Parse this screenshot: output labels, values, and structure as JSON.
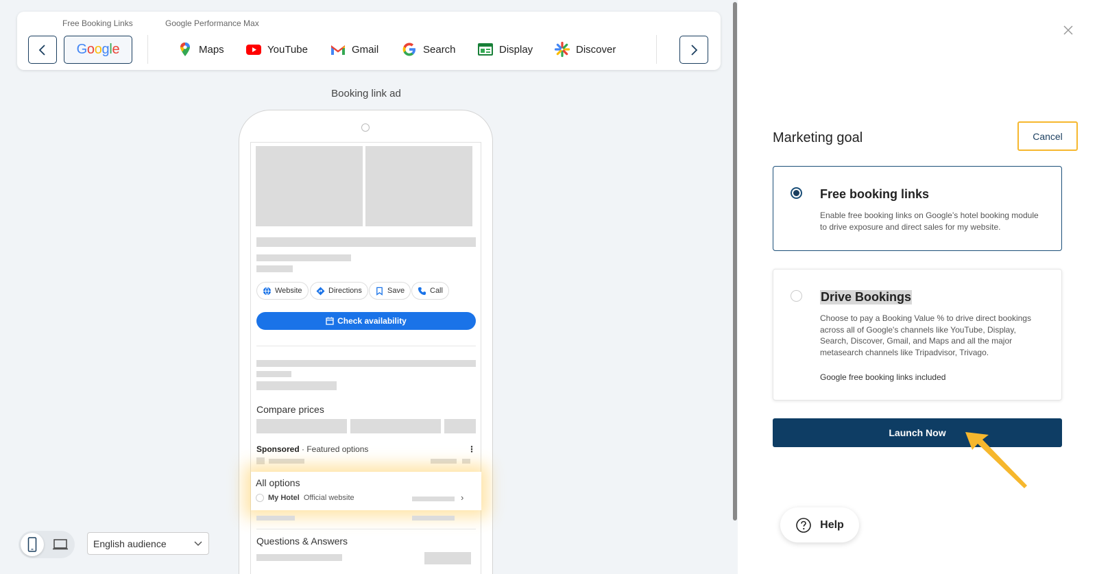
{
  "channels": {
    "free_booking_links_label": "Free Booking Links",
    "performance_max_label": "Google Performance Max",
    "google_label": "Google",
    "items": [
      {
        "label": "Maps",
        "icon": "maps-pin-icon"
      },
      {
        "label": "YouTube",
        "icon": "youtube-icon"
      },
      {
        "label": "Gmail",
        "icon": "gmail-icon"
      },
      {
        "label": "Search",
        "icon": "google-g-icon"
      },
      {
        "label": "Display",
        "icon": "display-icon"
      },
      {
        "label": "Discover",
        "icon": "discover-icon"
      }
    ]
  },
  "preview": {
    "title": "Booking link ad",
    "chips": [
      "Website",
      "Directions",
      "Save",
      "Call"
    ],
    "check_availability": "Check availability",
    "compare_prices": "Compare prices",
    "sponsored": "Sponsored",
    "featured_options": "· Featured options",
    "all_options": "All options",
    "hotel_name": "My Hotel",
    "official_website": "Official website",
    "questions_answers": "Questions & Answers"
  },
  "controls": {
    "language": "English audience"
  },
  "goal_panel": {
    "title": "Marketing goal",
    "cancel": "Cancel",
    "option_free": {
      "title": "Free booking links",
      "description": "Enable free booking links on Google’s hotel booking module to drive exposure and direct sales for my website.",
      "selected": true
    },
    "option_drive": {
      "title": "Drive Bookings",
      "description": "Choose to pay a Booking Value % to drive direct bookings across all of Google's channels like YouTube, Display, Search, Discover, Gmail, and Maps and all the major metasearch channels like Tripadvisor, Trivago.",
      "note": "Google free booking links included",
      "selected": false
    },
    "launch": "Launch Now",
    "help": "Help"
  },
  "colors": {
    "primary": "#0e3d64",
    "highlight": "#f6b72d",
    "google_blue": "#1a73e8"
  }
}
